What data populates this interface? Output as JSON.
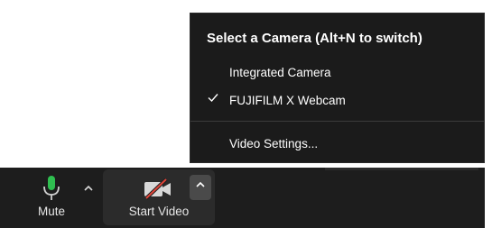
{
  "camera_menu": {
    "title": "Select a Camera (Alt+N to switch)",
    "items": [
      {
        "label": "Integrated Camera",
        "checked": false
      },
      {
        "label": "FUJIFILM X Webcam",
        "checked": true
      }
    ],
    "settings_label": "Video Settings..."
  },
  "toolbar": {
    "mute_label": "Mute",
    "start_video_label": "Start Video"
  },
  "colors": {
    "mic_accent": "#2fbf50",
    "video_off_slash": "#e0453a",
    "menu_bg": "#1b1b1b",
    "toolbar_bg": "#1d1d1d"
  },
  "icons": {
    "mute_button": "microphone-icon",
    "video_button": "video-off-icon",
    "audio_caret": "chevron-up-icon",
    "video_caret": "chevron-up-icon",
    "checked_item": "checkmark-icon"
  }
}
